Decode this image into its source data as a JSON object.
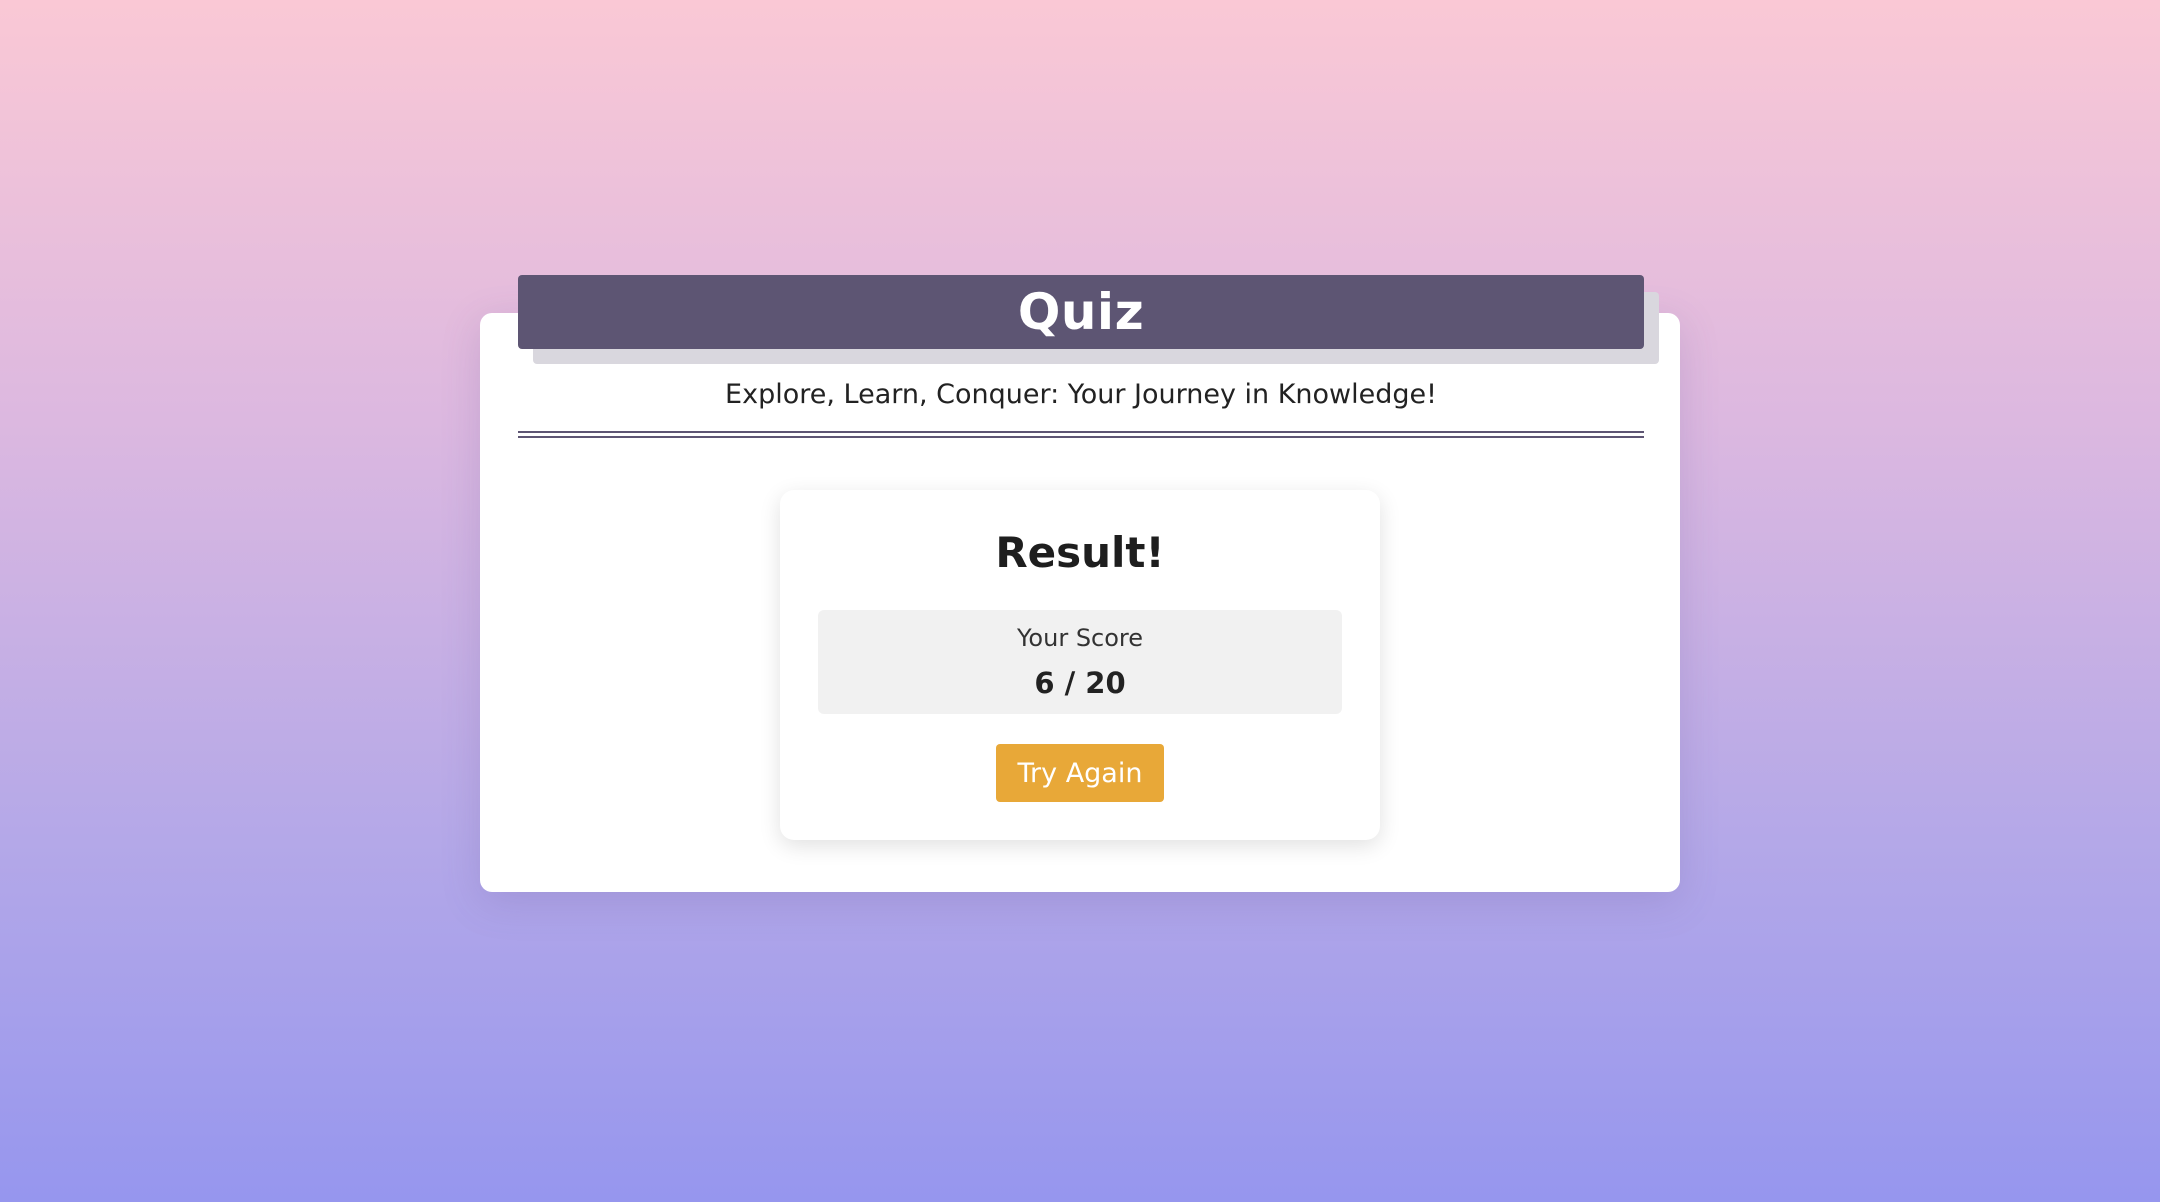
{
  "header": {
    "title": "Quiz",
    "tagline": "Explore, Learn, Conquer: Your Journey in Knowledge!"
  },
  "result": {
    "title": "Result!",
    "score_label": "Your Score",
    "score_value": "6 / 20",
    "score": 6,
    "score_total": 20,
    "button_label": "Try Again"
  },
  "colors": {
    "background_top": "#fac8d5",
    "background_bottom": "#9696ee",
    "header_bar": "#5d5573",
    "button": "#e8a838",
    "score_box": "#f1f1f1"
  }
}
